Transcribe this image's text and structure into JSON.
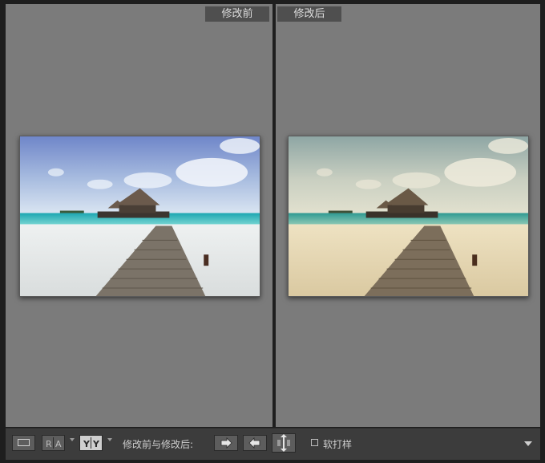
{
  "panes": {
    "before_label": "修改前",
    "after_label": "修改后"
  },
  "toolbar": {
    "view_mode_label": "修改前与修改后:",
    "soft_proof_label": "软打样",
    "ra_glyph_1": "R",
    "ra_glyph_2": "A",
    "yy_glyph_1": "Y",
    "yy_glyph_2": "Y"
  },
  "colors": {
    "panel_bg": "#7b7b7b",
    "toolbar_bg": "#3c3c3c",
    "label_bg": "#4f4f4f",
    "after_tint": "#e2d2a8"
  },
  "icons": {
    "single_view": "single-view-icon",
    "side_by_side_ra": "side-by-side-icon",
    "split_yy": "split-view-icon",
    "copy_before_to_after": "copy-settings-right-icon",
    "copy_after_to_before": "copy-settings-left-icon",
    "swap": "swap-icon",
    "toolbar_menu": "menu-triangle-icon"
  }
}
